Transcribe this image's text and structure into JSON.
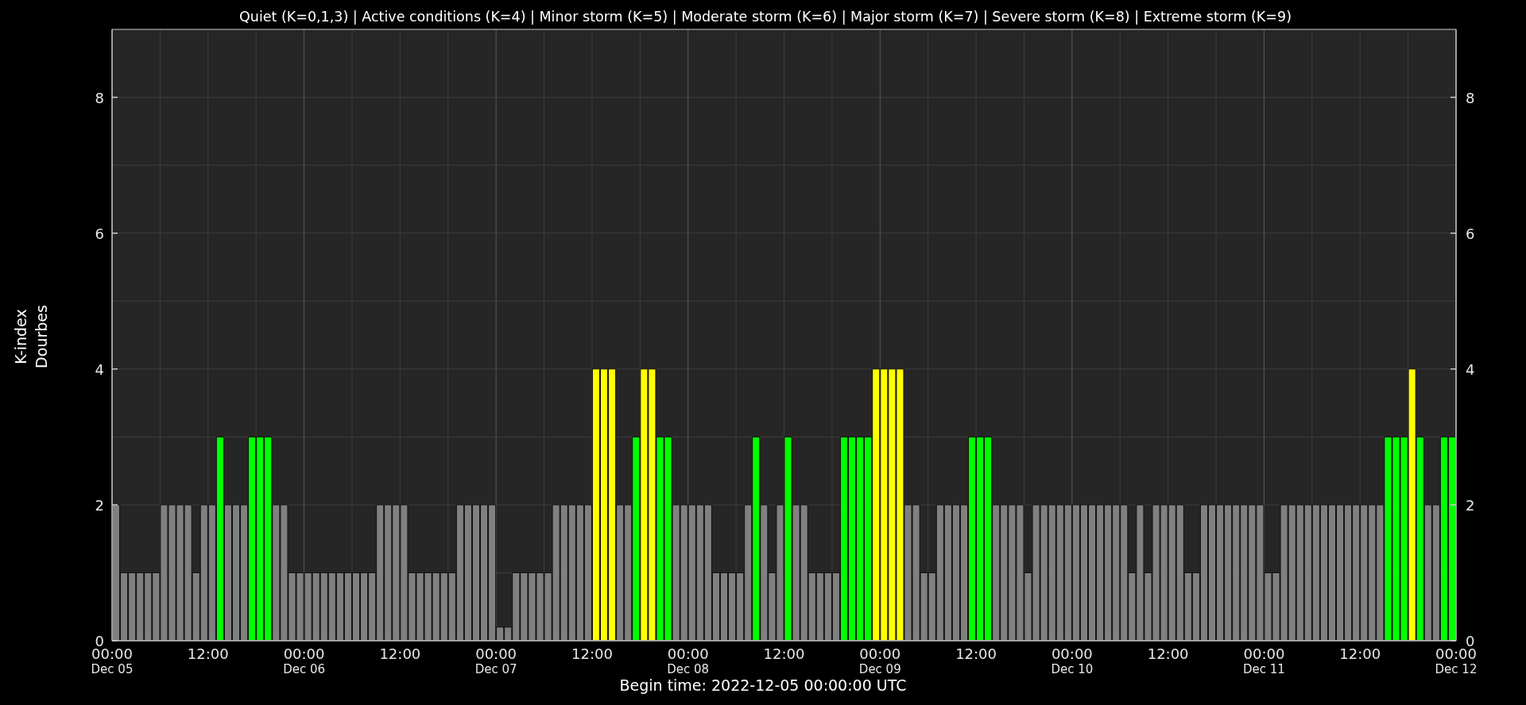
{
  "chart": {
    "chart_data": {
      "type": "bar",
      "title": "Quiet (K=0,1,3) | Active conditions (K=4) | Minor storm (K=5) | Moderate storm (K=6) | Major storm (K=7) | Severe storm (K=8) | Extreme storm (K=9)",
      "xlabel": "Begin time: 2022-12-05 00:00:00 UTC",
      "ylabel": "K-index\nDourbes",
      "grid": true,
      "ylim": [
        0,
        9
      ],
      "yticks": [
        0,
        2,
        4,
        6,
        8
      ],
      "categories": [
        "00:00\nDec 05",
        null,
        null,
        null,
        null,
        null,
        null,
        null,
        null,
        null,
        null,
        null,
        "12:00",
        null,
        null,
        null,
        null,
        null,
        null,
        null,
        null,
        null,
        null,
        null,
        "00:00\nDec 06",
        null,
        null,
        null,
        null,
        null,
        null,
        null,
        null,
        null,
        null,
        null,
        "12:00",
        null,
        null,
        null,
        null,
        null,
        null,
        null,
        null,
        null,
        null,
        null,
        "00:00\nDec 07",
        null,
        null,
        null,
        null,
        null,
        null,
        null,
        null,
        null,
        null,
        null,
        "12:00",
        null,
        null,
        null,
        null,
        null,
        null,
        null,
        null,
        null,
        null,
        null,
        "00:00\nDec 08",
        null,
        null,
        null,
        null,
        null,
        null,
        null,
        null,
        null,
        null,
        null,
        "12:00",
        null,
        null,
        null,
        null,
        null,
        null,
        null,
        null,
        null,
        null,
        null,
        "00:00\nDec 09",
        null,
        null,
        null,
        null,
        null,
        null,
        null,
        null,
        null,
        null,
        null,
        "12:00",
        null,
        null,
        null,
        null,
        null,
        null,
        null,
        null,
        null,
        null,
        null,
        "00:00\nDec 10",
        null,
        null,
        null,
        null,
        null,
        null,
        null,
        null,
        null,
        null,
        null,
        "12:00",
        null,
        null,
        null,
        null,
        null,
        null,
        null,
        null,
        null,
        null,
        null,
        "00:00\nDec 11",
        null,
        null,
        null,
        null,
        null,
        null,
        null,
        null,
        null,
        null,
        null,
        "12:00",
        null,
        null,
        null,
        null,
        null,
        null,
        null,
        null,
        null,
        null,
        null
      ],
      "series": [
        {
          "color": "#808080",
          "values": [
            2,
            1,
            1,
            1,
            1,
            1,
            2,
            2,
            2,
            2,
            1,
            2,
            2,
            null,
            2,
            2,
            2,
            null,
            null,
            null,
            2,
            2,
            1,
            1,
            1,
            1,
            1,
            1,
            1,
            1,
            1,
            1,
            1,
            2,
            2,
            2,
            2,
            1,
            1,
            1,
            1,
            1,
            1,
            2,
            2,
            2,
            2,
            2,
            0.2,
            0.2,
            1,
            1,
            1,
            1,
            1,
            2,
            2,
            2,
            2,
            2,
            null,
            null,
            null,
            2,
            2,
            null,
            null,
            null,
            null,
            null,
            2,
            2,
            2,
            2,
            2,
            1,
            1,
            1,
            1,
            2,
            null,
            2,
            1,
            2,
            null,
            2,
            2,
            1,
            1,
            1,
            1,
            null,
            null,
            null,
            null,
            null,
            null,
            null,
            null,
            2,
            2,
            1,
            1,
            2,
            2,
            2,
            2,
            null,
            null,
            null,
            2,
            2,
            2,
            2,
            1,
            2,
            2,
            2,
            2,
            2,
            2,
            2,
            2,
            2,
            2,
            2,
            2,
            1,
            2,
            1,
            2,
            2,
            2,
            2,
            1,
            1,
            2,
            2,
            2,
            2,
            2,
            2,
            2,
            2,
            1,
            1,
            2,
            2,
            2,
            2,
            2,
            2,
            2,
            2,
            2,
            2,
            2,
            2,
            2,
            null,
            null,
            null,
            null,
            null,
            2,
            2,
            null,
            null
          ]
        },
        {
          "color": "#00ff00",
          "values": [
            null,
            null,
            null,
            null,
            null,
            null,
            null,
            null,
            null,
            null,
            null,
            null,
            null,
            3,
            null,
            null,
            null,
            3,
            3,
            3,
            null,
            null,
            null,
            null,
            null,
            null,
            null,
            null,
            null,
            null,
            null,
            null,
            null,
            null,
            null,
            null,
            null,
            null,
            null,
            null,
            null,
            null,
            null,
            null,
            null,
            null,
            null,
            null,
            null,
            null,
            null,
            null,
            null,
            null,
            null,
            null,
            null,
            null,
            null,
            null,
            null,
            null,
            null,
            null,
            null,
            3,
            null,
            null,
            3,
            3,
            null,
            null,
            null,
            null,
            null,
            null,
            null,
            null,
            null,
            null,
            3,
            null,
            null,
            null,
            3,
            null,
            null,
            null,
            null,
            null,
            null,
            3,
            3,
            3,
            3,
            null,
            null,
            null,
            null,
            null,
            null,
            null,
            null,
            null,
            null,
            null,
            null,
            3,
            3,
            3,
            null,
            null,
            null,
            null,
            null,
            null,
            null,
            null,
            null,
            null,
            null,
            null,
            null,
            null,
            null,
            null,
            null,
            null,
            null,
            null,
            null,
            null,
            null,
            null,
            null,
            null,
            null,
            null,
            null,
            null,
            null,
            null,
            null,
            null,
            null,
            null,
            null,
            null,
            null,
            null,
            null,
            null,
            null,
            null,
            null,
            null,
            null,
            null,
            null,
            3,
            3,
            3,
            null,
            3,
            null,
            null,
            3,
            3
          ]
        },
        {
          "color": "#ffff00",
          "values": [
            null,
            null,
            null,
            null,
            null,
            null,
            null,
            null,
            null,
            null,
            null,
            null,
            null,
            null,
            null,
            null,
            null,
            null,
            null,
            null,
            null,
            null,
            null,
            null,
            null,
            null,
            null,
            null,
            null,
            null,
            null,
            null,
            null,
            null,
            null,
            null,
            null,
            null,
            null,
            null,
            null,
            null,
            null,
            null,
            null,
            null,
            null,
            null,
            null,
            null,
            null,
            null,
            null,
            null,
            null,
            null,
            null,
            null,
            null,
            null,
            4,
            4,
            4,
            null,
            null,
            null,
            4,
            4,
            null,
            null,
            null,
            null,
            null,
            null,
            null,
            null,
            null,
            null,
            null,
            null,
            null,
            null,
            null,
            null,
            null,
            null,
            null,
            null,
            null,
            null,
            null,
            null,
            null,
            null,
            null,
            4,
            4,
            4,
            4,
            null,
            null,
            null,
            null,
            null,
            null,
            null,
            null,
            null,
            null,
            null,
            null,
            null,
            null,
            null,
            null,
            null,
            null,
            null,
            null,
            null,
            null,
            null,
            null,
            null,
            null,
            null,
            null,
            null,
            null,
            null,
            null,
            null,
            null,
            null,
            null,
            null,
            null,
            null,
            null,
            null,
            null,
            null,
            null,
            null,
            null,
            null,
            null,
            null,
            null,
            null,
            null,
            null,
            null,
            null,
            null,
            null,
            null,
            null,
            null,
            null,
            null,
            null,
            4,
            null,
            null,
            null,
            null,
            null
          ]
        }
      ]
    },
    "x_end_label": "00:00\nDec 12",
    "right_axis": {
      "ticks": [
        "8",
        "6",
        "4",
        "2",
        "0"
      ]
    }
  }
}
